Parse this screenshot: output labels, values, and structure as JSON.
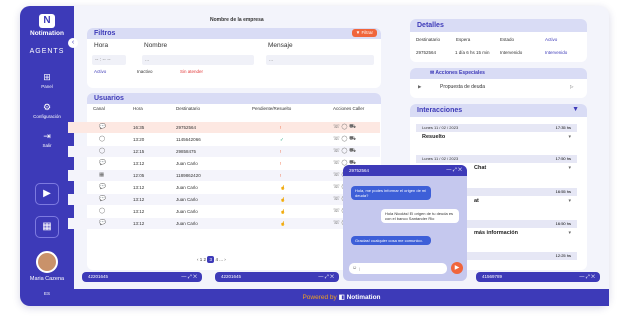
{
  "sidebar": {
    "logo_letter": "N",
    "brand": "Notimation",
    "module": "AGENTS",
    "collapse_icon": "‹",
    "items": [
      {
        "icon": "⊞",
        "label": "Panel"
      },
      {
        "icon": "⚙",
        "label": "Configuración"
      },
      {
        "icon": "⇥",
        "label": "Salir"
      }
    ],
    "play_icon": "▶",
    "qr_icon": "▦",
    "user_name": "Maria Cazena",
    "lang": "ES"
  },
  "company_name": "Nombre de la empresa",
  "filters": {
    "title": "Filtros",
    "filter_button": "Filtrar",
    "hora_label": "Hora",
    "hora_value": "-- : -- --",
    "nombre_label": "Nombre",
    "nombre_value": "...",
    "mensaje_label": "Mensaje",
    "mensaje_value": "...",
    "status": [
      "Activo",
      "Inactivo",
      "Sin atender"
    ]
  },
  "users": {
    "title": "Usuarios",
    "columns": [
      "Canal",
      "Hora",
      "Destinatario",
      "Pendiente/Resuelto",
      "Acciones Caller"
    ],
    "rows": [
      {
        "canal": "💬",
        "hora": "16:35",
        "dest": "29752564",
        "estado": "!"
      },
      {
        "canal": "◯",
        "hora": "13:20",
        "dest": "1145642066",
        "estado": "✓"
      },
      {
        "canal": "◯",
        "hora": "12:15",
        "dest": "29858475",
        "estado": "!"
      },
      {
        "canal": "💬",
        "hora": "13:12",
        "dest": "Juan Carlo",
        "estado": "!"
      },
      {
        "canal": "▦",
        "hora": "12:05",
        "dest": "1189862420",
        "estado": "!"
      },
      {
        "canal": "💬",
        "hora": "13:12",
        "dest": "Juan Carlo",
        "estado": "☝"
      },
      {
        "canal": "💬",
        "hora": "13:12",
        "dest": "Juan Carlo",
        "estado": "☝"
      },
      {
        "canal": "◯",
        "hora": "13:12",
        "dest": "Juan Carlo",
        "estado": "☝"
      },
      {
        "canal": "💬",
        "hora": "13:12",
        "dest": "Juan Carlo",
        "estado": "☝"
      }
    ],
    "actions": "☏ ◯ ⛟",
    "pager": {
      "prev": "‹ 1 2",
      "current": "3",
      "next": "4 ... ›"
    }
  },
  "bars": [
    {
      "label": "42201645",
      "controls": "— ⤢ ✕"
    },
    {
      "label": "42201645",
      "controls": "— ⤢ ✕"
    },
    {
      "label": "41569789",
      "controls": "— ⤢ ✕"
    }
  ],
  "chat": {
    "title": "29752564",
    "controls": "— ⤢ ✕",
    "messages": [
      {
        "text": "Hola, me podes informar el origen de mi deuda?"
      },
      {
        "text": "Hola Nicolás! El origen de tu deuda es con el banco Santander Rio"
      },
      {
        "text": "Gracias! cualquier cosa me comunico."
      }
    ],
    "input_placeholder": "|",
    "send_icon": "▶"
  },
  "details": {
    "title": "Detalles",
    "headers": [
      "Destinatario",
      "Espera",
      "Estado",
      "Activo"
    ],
    "values": [
      "29752564",
      "1 día 6 hs 15 min",
      "Intervenido",
      "Intervenido"
    ]
  },
  "special_actions": {
    "title": "Acciones Especiales",
    "item": "Propuesta de deuda"
  },
  "interactions": {
    "title": "Interacciones",
    "items": [
      {
        "date": "Lunes 11 / 02 / 2023",
        "time": "17:35 hs",
        "title": "Resuelto"
      },
      {
        "date": "Lunes 11 / 02 / 2023",
        "time": "17:50 hs",
        "title": "Chat"
      },
      {
        "date": "",
        "time": "16:55 hs",
        "title": "at"
      },
      {
        "date": "",
        "time": "16:50 hs",
        "title": "más información"
      },
      {
        "date": "",
        "time": "12:25 hs",
        "title": ""
      }
    ]
  },
  "footer": {
    "powered": "Powered by",
    "brand": "Notimation"
  }
}
